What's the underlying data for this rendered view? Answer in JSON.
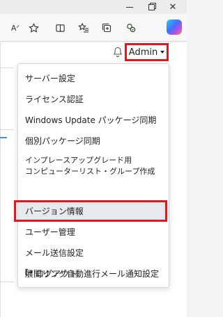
{
  "browser": {
    "window_controls": [
      "minimize-icon",
      "restore-icon",
      "close-icon"
    ],
    "toolbar_icons": [
      "read-aloud-icon",
      "favorite-star-icon",
      "split-screen-icon",
      "favorites-icon",
      "collections-icon",
      "extension-icon",
      "copilot-icon"
    ],
    "read_aloud_glyph": "Aᐟ"
  },
  "header": {
    "user_label": "Admin"
  },
  "menu": {
    "items": [
      {
        "label": "サーバー設定"
      },
      {
        "label": "ライセンス認証"
      },
      {
        "label": "Windows Update パッケージ同期"
      },
      {
        "label": "個別パッケージ同期"
      },
      {
        "label_line1": "インプレースアップグレード用",
        "label_line2": "コンピューターリスト・グループ作成"
      },
      {
        "label": "バージョン情報"
      },
      {
        "label": "ユーザー管理"
      },
      {
        "label": "メール送信設定"
      },
      {
        "label": "展開リング自動進行メール通知設定"
      },
      {
        "label": "ログアウト",
        "icon": "logout-icon"
      }
    ]
  },
  "colors": {
    "highlight": "#e0191f",
    "active_item_bg": "#e6e9ee"
  }
}
